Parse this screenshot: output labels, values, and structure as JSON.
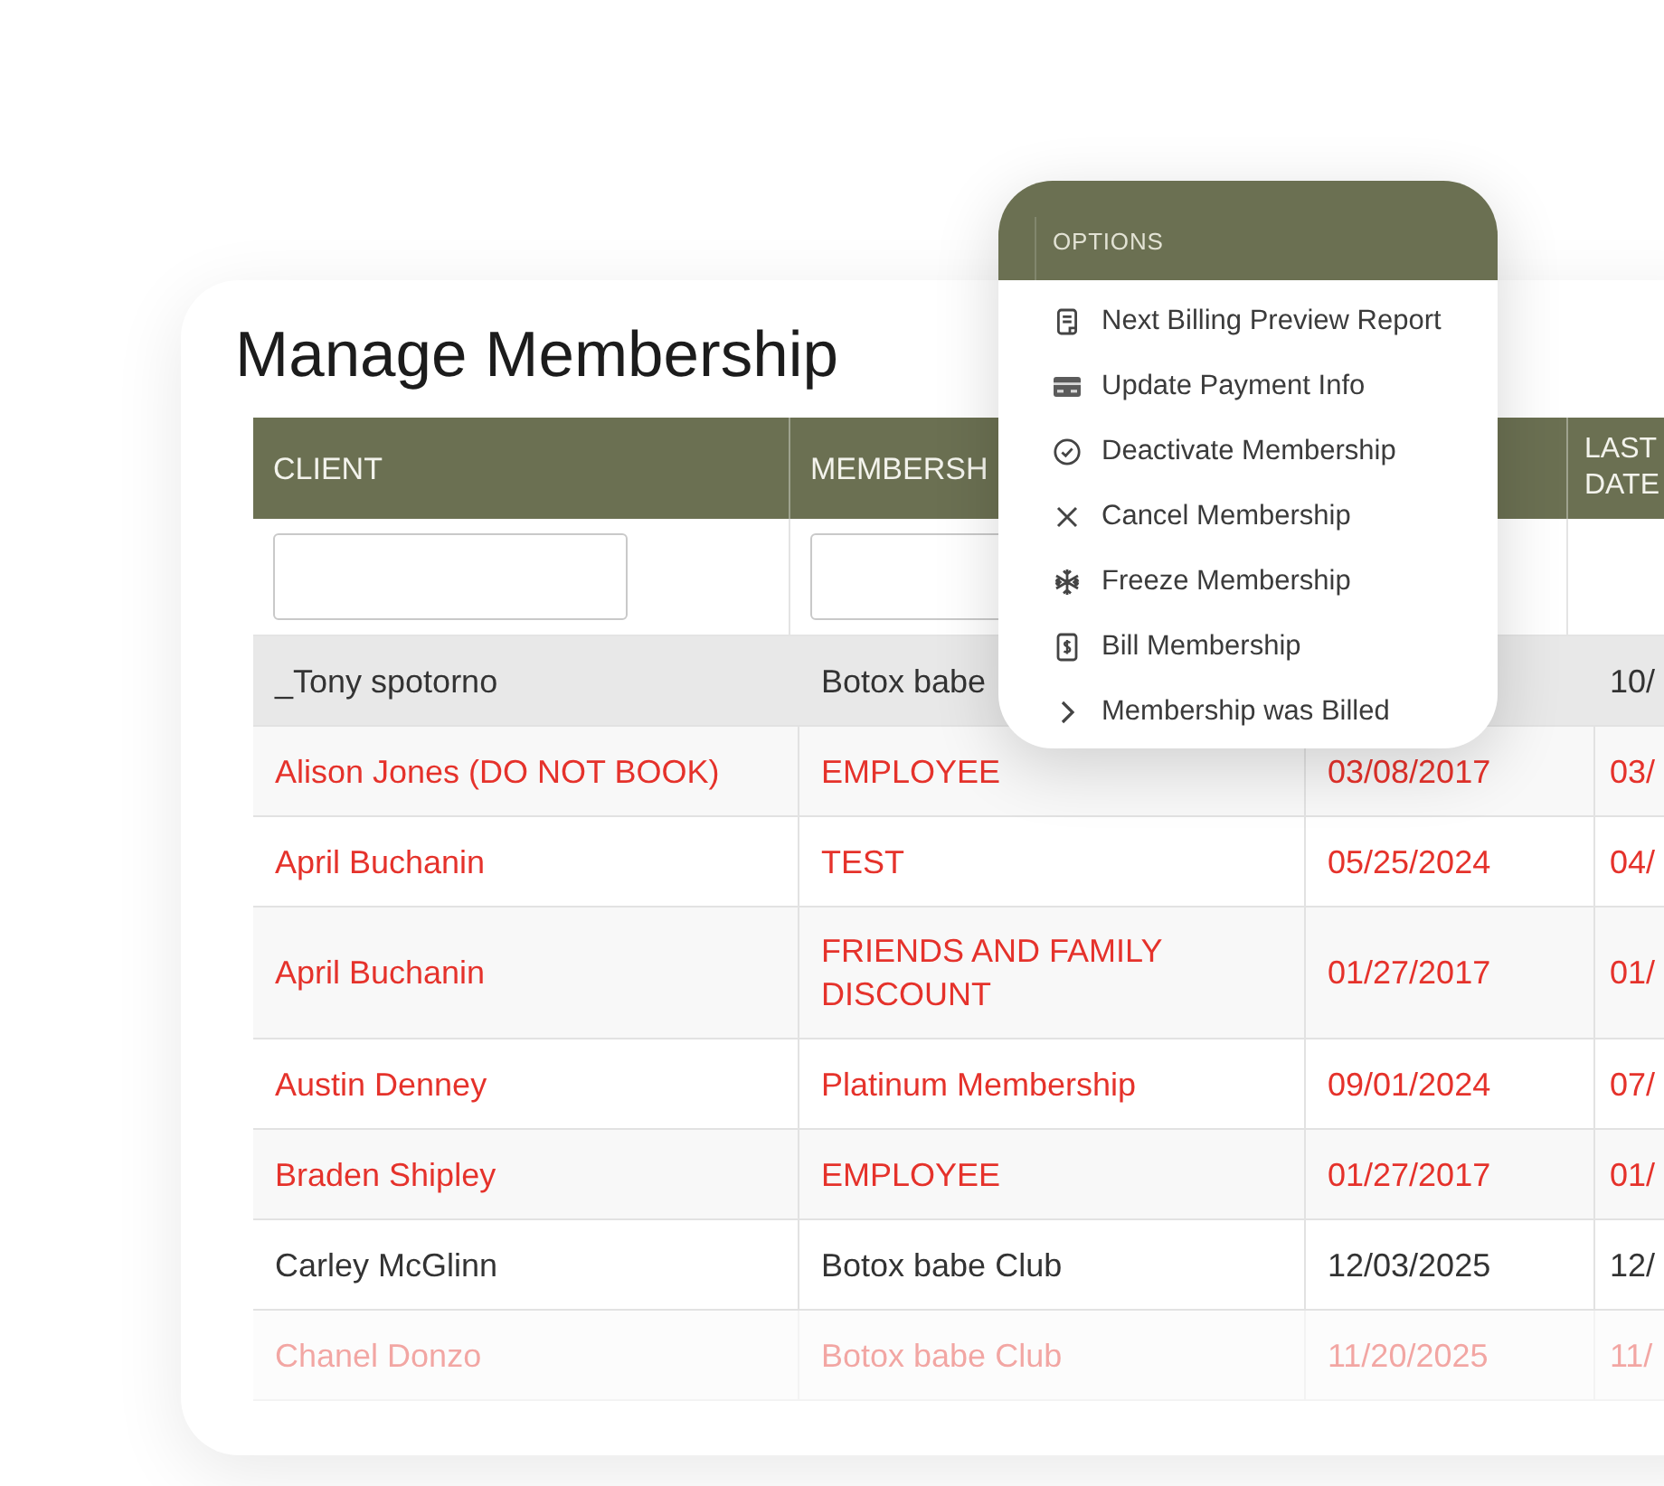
{
  "page": {
    "title": "Manage Membership"
  },
  "table": {
    "columns": [
      {
        "label": "CLIENT",
        "kind": "text_filter"
      },
      {
        "label": "MEMBERSH",
        "kind": "text_filter"
      },
      {
        "kind": "no_filter"
      },
      {
        "label": "LAST DATE",
        "kind": "no_filter"
      }
    ],
    "rows": [
      {
        "client": "_Tony spotorno",
        "membership": "Botox babe",
        "last_date": "10/",
        "selected": true,
        "inactive": false
      },
      {
        "client": "Alison Jones (DO NOT BOOK)",
        "membership": "EMPLOYEE",
        "column_3": "03/08/2017",
        "last_date": "03/",
        "selected": false,
        "inactive": true
      },
      {
        "client": "April Buchanin",
        "membership": "TEST",
        "column_3": "05/25/2024",
        "last_date": "04/",
        "selected": false,
        "inactive": true
      },
      {
        "client": "April Buchanin",
        "membership": "FRIENDS AND FAMILY DISCOUNT",
        "column_3": "01/27/2017",
        "last_date": "01/",
        "selected": false,
        "inactive": true
      },
      {
        "client": "Austin Denney",
        "membership": "Platinum Membership",
        "column_3": "09/01/2024",
        "last_date": "07/",
        "selected": false,
        "inactive": true
      },
      {
        "client": "Braden Shipley",
        "membership": "EMPLOYEE",
        "column_3": "01/27/2017",
        "last_date": "01/",
        "selected": false,
        "inactive": true
      },
      {
        "client": "Carley McGlinn",
        "membership": "Botox babe Club",
        "column_3": "12/03/2025",
        "last_date": "12/",
        "selected": false,
        "inactive": false
      },
      {
        "client": "Chanel Donzo",
        "membership": "Botox babe Club",
        "column_3": "11/20/2025",
        "last_date": "11/",
        "selected": false,
        "inactive": true
      }
    ]
  },
  "options_menu": {
    "title": "OPTIONS",
    "items": [
      {
        "label": "Next Billing Preview Report"
      },
      {
        "label": "Update Payment Info"
      },
      {
        "label": "Deactivate Membership"
      },
      {
        "label": "Cancel Membership"
      },
      {
        "label": "Freeze Membership"
      },
      {
        "label": "Bill Membership"
      },
      {
        "label": "Membership was Billed"
      }
    ]
  }
}
